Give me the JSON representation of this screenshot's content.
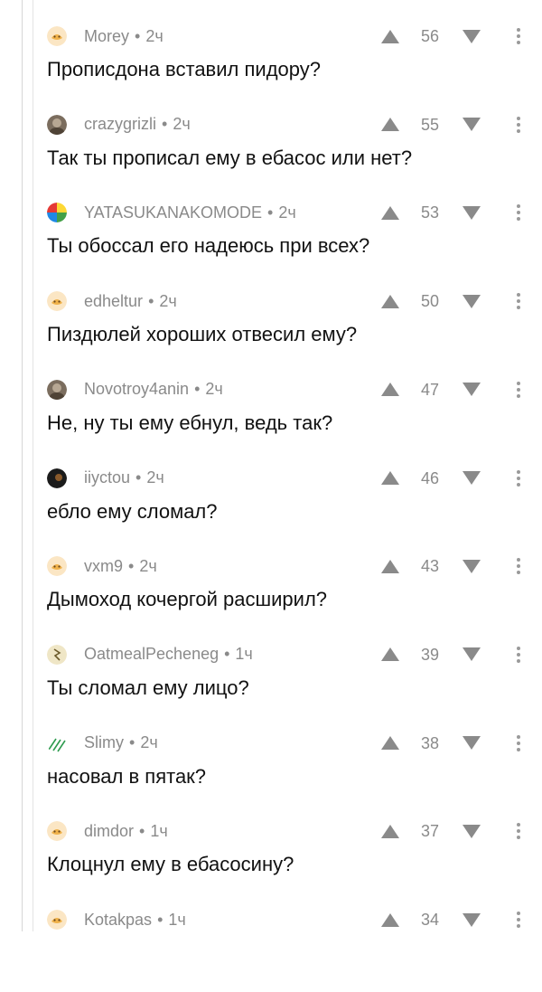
{
  "comments": [
    {
      "user": "Morey",
      "time": "2ч",
      "rating": "56",
      "text": "Прописдона вставил пидору?",
      "avatar": "peach-avatar-icon"
    },
    {
      "user": "crazygrizli",
      "time": "2ч",
      "rating": "55",
      "text": "Так ты прописал ему в ебасос или нет?",
      "avatar": "photo-avatar-icon"
    },
    {
      "user": "YATASUKANAKOMODE",
      "time": "2ч",
      "rating": "53",
      "text": "Ты обоссал его надеюсь при всех?",
      "avatar": "colorful-avatar-icon"
    },
    {
      "user": "edheltur",
      "time": "2ч",
      "rating": "50",
      "text": "Пиздюлей хороших отвесил ему?",
      "avatar": "peach-avatar-icon"
    },
    {
      "user": "Novotroy4anin",
      "time": "2ч",
      "rating": "47",
      "text": "Не, ну ты ему ебнул, ведь так?",
      "avatar": "photo-avatar-icon"
    },
    {
      "user": "iiyctou",
      "time": "2ч",
      "rating": "46",
      "text": "ебло ему сломал?",
      "avatar": "dark-avatar-icon"
    },
    {
      "user": "vxm9",
      "time": "2ч",
      "rating": "43",
      "text": "Дымоход кочергой расширил?",
      "avatar": "peach-avatar-icon"
    },
    {
      "user": "OatmealPecheneg",
      "time": "1ч",
      "rating": "39",
      "text": "Ты сломал ему лицо?",
      "avatar": "drawing-avatar-icon"
    },
    {
      "user": "Slimy",
      "time": "2ч",
      "rating": "38",
      "text": "насовал в пятак?",
      "avatar": "green-lines-avatar-icon"
    },
    {
      "user": "dimdor",
      "time": "1ч",
      "rating": "37",
      "text": "Клоцнул ему в ебасосину?",
      "avatar": "peach-avatar-icon"
    },
    {
      "user": "Kotakpas",
      "time": "1ч",
      "rating": "34",
      "text": "",
      "avatar": "peach-avatar-icon"
    }
  ],
  "colors": {
    "meta": "#8a8a8a",
    "vote_arrow": "#8a8a8a",
    "text": "#111111",
    "thread_line": "#d7d7d7"
  },
  "icons": {
    "upvote": "upvote-icon",
    "downvote": "downvote-icon",
    "more": "more-options-icon"
  }
}
